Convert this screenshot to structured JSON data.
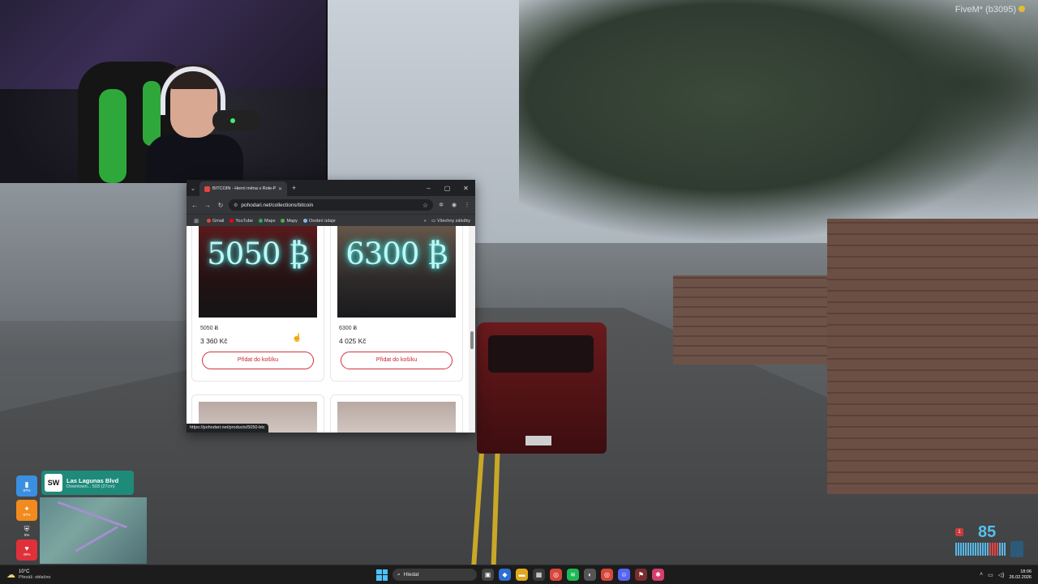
{
  "overlay": {
    "brand": "FiveM* (b3095)"
  },
  "browser": {
    "tab_title": "BITCOIN - Herní měna v Role-P",
    "url": "pohodari.net/collections/bitcoin",
    "bookmarks": [
      {
        "label": "Gmail",
        "color": "#ea4335"
      },
      {
        "label": "YouTube",
        "color": "#ff0000"
      },
      {
        "label": "Maps",
        "color": "#34a853"
      },
      {
        "label": "Mapy",
        "color": "#4caf50"
      },
      {
        "label": "Osobní údaje",
        "color": "#8ab4f8"
      }
    ],
    "all_bookmarks": "Všechny záložky",
    "status_url": "https://pohodari.net/products/5050-btc",
    "products": [
      {
        "art": "5050 ₿",
        "name": "5050 Ƀ",
        "price": "3 360 Kč",
        "button": "Přidat do košíku"
      },
      {
        "art": "6300 ₿",
        "name": "6300 Ƀ",
        "price": "4 025 Kč",
        "button": "Přidat do košíku"
      }
    ]
  },
  "hud": {
    "street_badge": "SW",
    "street_name": "Las Lagunas Blvd",
    "street_sub": "Downtown... 503 (27cm)",
    "stats": [
      {
        "icon": "water-icon",
        "glyph": "▮",
        "value": "97%",
        "color": "#3b8fe0"
      },
      {
        "icon": "food-icon",
        "glyph": "✦",
        "value": "97%",
        "color": "#f28a1e"
      },
      {
        "icon": "armor-icon",
        "glyph": "⛨",
        "value": "0%",
        "color": "transparent"
      },
      {
        "icon": "health-icon",
        "glyph": "♥",
        "value": "49%",
        "color": "#e0303a"
      }
    ],
    "speed": "85",
    "gear": "1"
  },
  "taskbar": {
    "weather_temp": "10°C",
    "weather_desc": "Převáž. oblačno",
    "search_placeholder": "Hledat",
    "time": "18:06",
    "date": "26.02.2026"
  }
}
